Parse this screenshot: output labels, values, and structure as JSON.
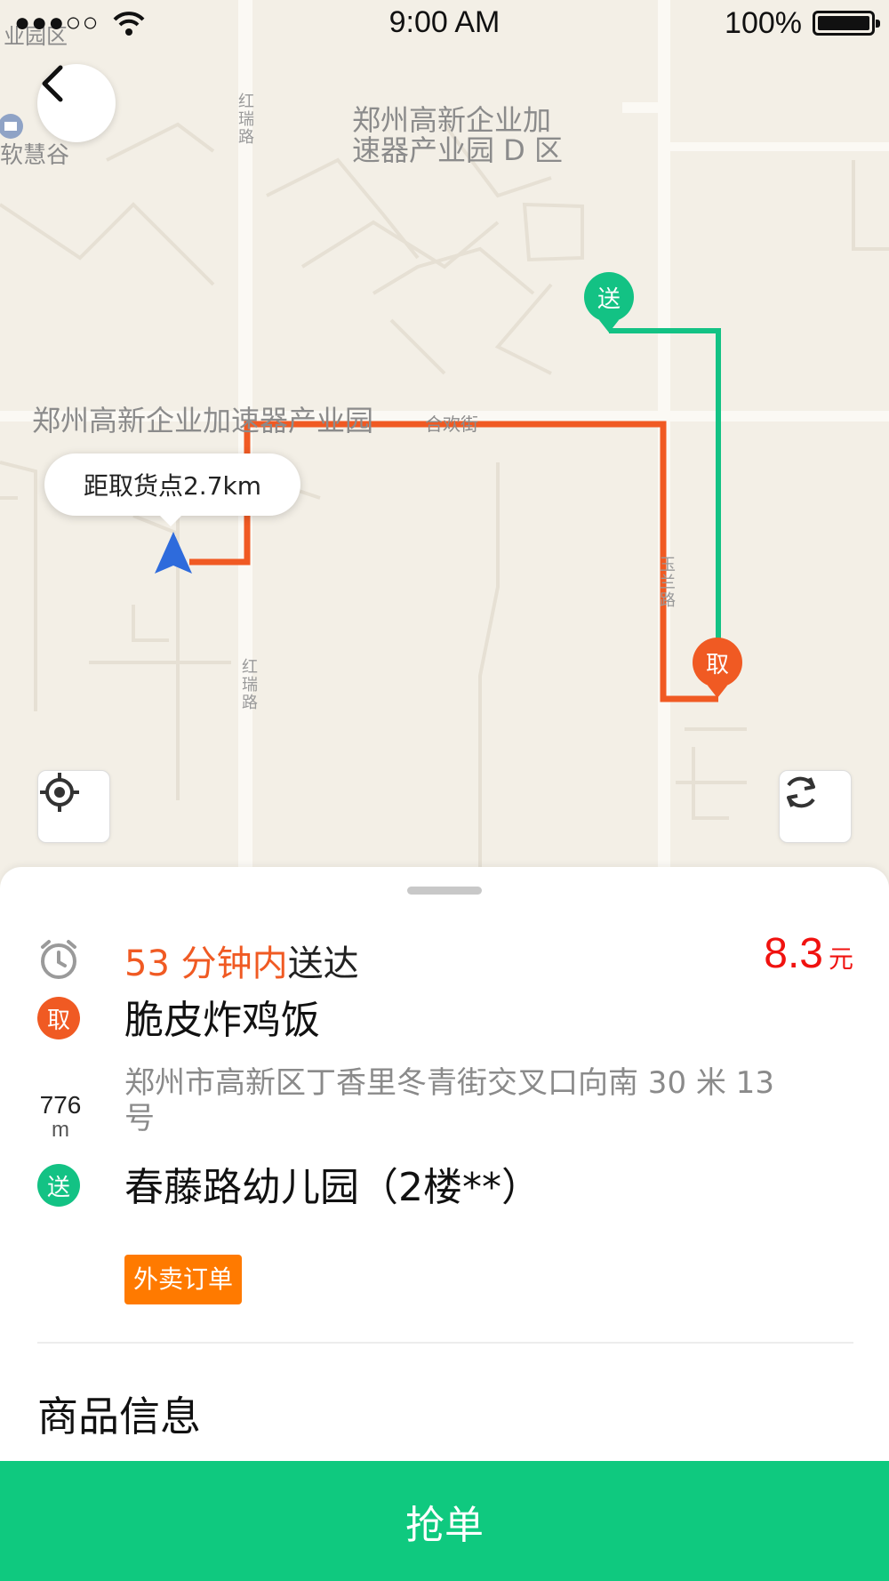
{
  "status_bar": {
    "signal": "●●●○○",
    "time": "9:00 AM",
    "battery_text": "100%"
  },
  "map": {
    "labels": {
      "top_left_area": "业园区",
      "left_poi": "软慧谷",
      "zone_d_line1": "郑州高新企业加",
      "zone_d_line2": "速器产业园 D 区",
      "park": "郑州高新企业加速器产业园",
      "street_hehuan": "合欢街",
      "road_hongrui_top": "红瑞路",
      "road_hongrui_bottom": "红瑞路",
      "road_right": "玉兰路"
    },
    "distance_tooltip": "距取货点2.7km",
    "pin_deliver": "送",
    "pin_pickup": "取",
    "route_colors": {
      "pickup_route": "#f05a23",
      "delivery_route": "#13c284"
    }
  },
  "order": {
    "time_prefix": "53 分钟内",
    "time_suffix": "送达",
    "price": "8.3",
    "price_unit": "元",
    "pickup_badge": "取",
    "pickup_name": "脆皮炸鸡饭",
    "pickup_distance_num": "776",
    "pickup_distance_unit": "m",
    "pickup_address": "郑州市高新区丁香里冬青街交叉口向南 30 米 13 号",
    "deliver_badge": "送",
    "deliver_name": "春藤路幼儿园（2楼**）",
    "order_tag": "外卖订单",
    "section_title": "商品信息"
  },
  "grab_button": "抢单",
  "colors": {
    "accent_green": "#0fc97f",
    "accent_orange": "#f05a23",
    "price_red": "#f0120f",
    "tag_orange": "#ff7a00"
  }
}
